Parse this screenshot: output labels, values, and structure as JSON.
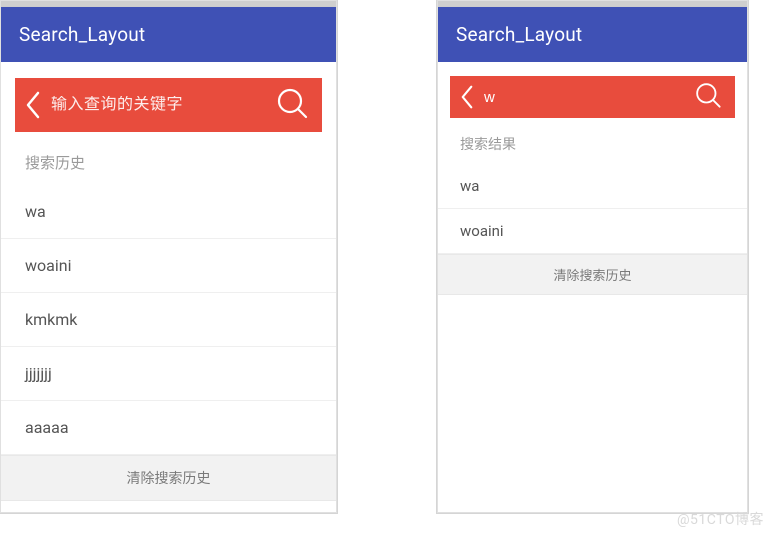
{
  "watermark": "@51CTO博客",
  "shared": {
    "app_bar_title": "Search_Layout",
    "clear_label": "清除搜索历史"
  },
  "left": {
    "search": {
      "placeholder": "输入查询的关键字",
      "value": ""
    },
    "section_label": "搜索历史",
    "history": [
      "wa",
      "woaini",
      "kmkmk",
      "jjjjjjj",
      "aaaaa"
    ]
  },
  "right": {
    "search": {
      "placeholder": "",
      "value": "w"
    },
    "section_label": "搜索结果",
    "results": [
      "wa",
      "woaini"
    ]
  }
}
